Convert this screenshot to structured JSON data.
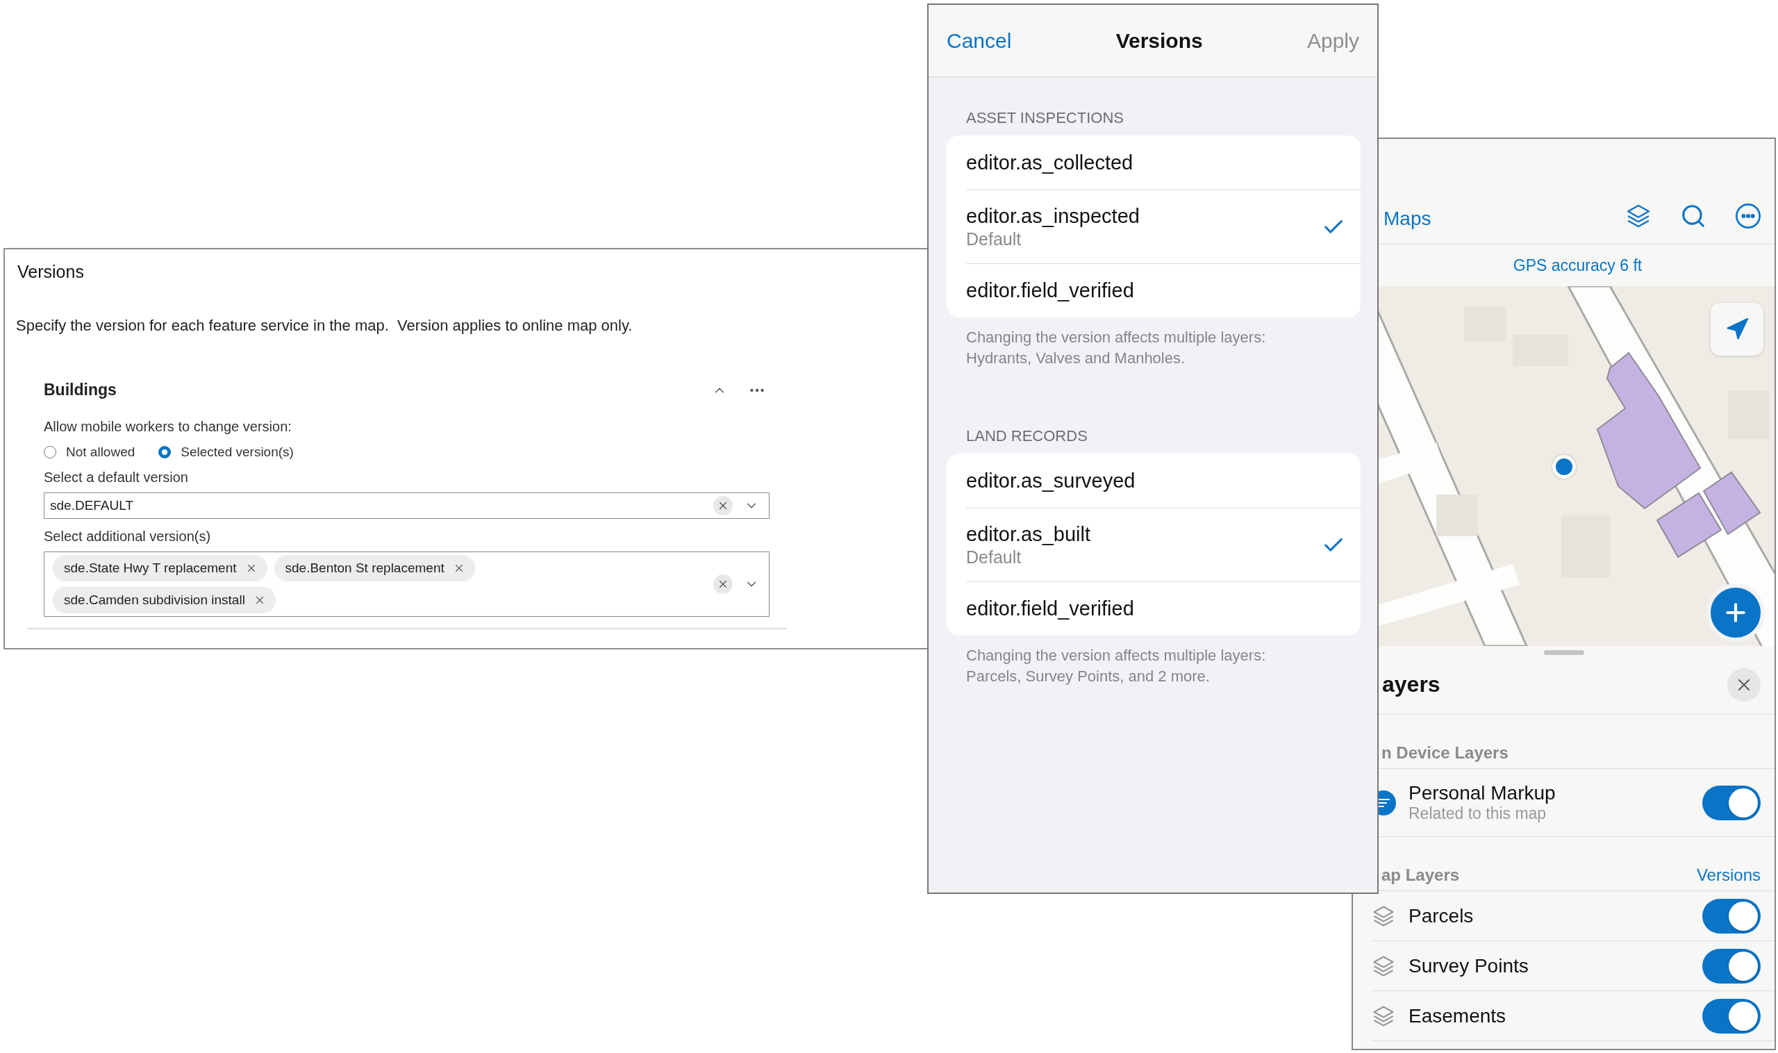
{
  "web_config": {
    "title": "Versions",
    "description": "Specify the version for each feature service in the map.  Version applies to online map only.",
    "layer": {
      "name": "Buildings",
      "expanded": true
    },
    "allow_label": "Allow mobile workers to change version:",
    "options": [
      {
        "label": "Not allowed",
        "selected": false
      },
      {
        "label": "Selected version(s)",
        "selected": true
      }
    ],
    "default_label": "Select a default version",
    "default_value": "sde.DEFAULT",
    "additional_label": "Select additional version(s)",
    "additional_chips": [
      "sde.State Hwy T replacement",
      "sde.Benton St replacement",
      "sde.Camden subdivision install"
    ]
  },
  "versions_dialog": {
    "cancel": "Cancel",
    "title": "Versions",
    "apply": "Apply",
    "apply_disabled": true,
    "sections": [
      {
        "header": "ASSET INSPECTIONS",
        "items": [
          {
            "name": "editor.as_collected",
            "selected": false
          },
          {
            "name": "editor.as_inspected",
            "subtitle": "Default",
            "selected": true
          },
          {
            "name": "editor.field_verified",
            "selected": false
          }
        ],
        "footnote": [
          "Changing the version affects multiple layers:",
          "Hydrants, Valves and Manholes."
        ]
      },
      {
        "header": "LAND RECORDS",
        "items": [
          {
            "name": "editor.as_surveyed",
            "selected": false
          },
          {
            "name": "editor.as_built",
            "subtitle": "Default",
            "selected": true
          },
          {
            "name": "editor.field_verified",
            "selected": false
          }
        ],
        "footnote": [
          "Changing the version affects multiple layers:",
          "Parcels, Survey Points, and 2 more."
        ]
      }
    ]
  },
  "mobile_map": {
    "back": "Maps",
    "gps": "GPS accuracy 6 ft",
    "layers_panel": {
      "title": "ayers",
      "on_device_header": "n Device Layers",
      "on_device_layers": [
        {
          "name": "Personal Markup",
          "subtitle": "Related to this map",
          "on": true
        }
      ],
      "map_layers_header": "ap Layers",
      "versions_link": "Versions",
      "map_layers": [
        {
          "name": "Parcels",
          "on": true
        },
        {
          "name": "Survey Points",
          "on": true
        },
        {
          "name": "Easements",
          "on": true
        }
      ]
    }
  }
}
